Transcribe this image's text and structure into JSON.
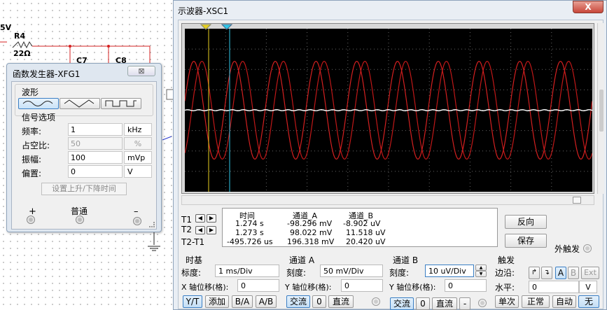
{
  "circuit": {
    "volt_fragment": "5V",
    "r4_label": "R4",
    "r4_value": "22Ω",
    "c7_label": "C7",
    "c8_label": "C8"
  },
  "func_gen": {
    "title": "函数发生器-XFG1",
    "close": "⊠",
    "waveform_label": "波形",
    "signal_options_label": "信号选项",
    "fields": [
      {
        "label": "频率:",
        "value": "1",
        "unit": "kHz"
      },
      {
        "label": "占空比:",
        "value": "50",
        "unit": "%"
      },
      {
        "label": "振幅:",
        "value": "100",
        "unit": "mVp"
      },
      {
        "label": "偏置:",
        "value": "0",
        "unit": "V"
      }
    ],
    "set_rise_fall": "设置上升/下降时间",
    "plus": "+",
    "common": "普通",
    "minus": "–"
  },
  "osc": {
    "title": "示波器-XSC1",
    "close": "X",
    "meas": {
      "headers": [
        "时间",
        "通道_A",
        "通道_B"
      ],
      "rows": [
        {
          "label": "T1",
          "time": "1.274 s",
          "a": "-98.296 mV",
          "b": "-8.902 uV"
        },
        {
          "label": "T2",
          "time": "1.273 s",
          "a": "98.022 mV",
          "b": "11.518 uV"
        },
        {
          "label": "T2-T1",
          "time": "-495.726 us",
          "a": "196.318 mV",
          "b": "20.420 uV"
        }
      ]
    },
    "reverse": "反向",
    "save": "保存",
    "ext_trigger": "外触发",
    "timebase": {
      "title": "时基",
      "scale_label": "标度:",
      "scale": "1 ms/Div",
      "xpos_label": "X 轴位移(格):",
      "xpos": "0",
      "buttons": [
        "Y/T",
        "添加",
        "B/A",
        "A/B"
      ]
    },
    "chA": {
      "title": "通道 A",
      "scale_label": "刻度:",
      "scale": "50 mV/Div",
      "ypos_label": "Y 轴位移(格):",
      "ypos": "0",
      "buttons": [
        "交流",
        "0",
        "直流"
      ]
    },
    "chB": {
      "title": "通道 B",
      "scale_label": "刻度:",
      "scale": "10 uV/Div",
      "ypos_label": "Y 轴位移(格):",
      "ypos": "0",
      "buttons": [
        "交流",
        "0",
        "直流",
        "-"
      ]
    },
    "trigger": {
      "title": "触发",
      "edge_label": "边沿:",
      "edge_buttons": [
        "A",
        "B",
        "Ext"
      ],
      "level_label": "水平:",
      "level": "0",
      "level_unit": "V",
      "modes": [
        "单次",
        "正常",
        "自动",
        "无"
      ]
    }
  },
  "chart_data": {
    "type": "line",
    "timebase": "1 ms/Div",
    "channel_a_scale": "50 mV/Div",
    "series": [
      {
        "name": "通道_A",
        "color": "#d42020",
        "amplitude_div": 2.0,
        "frequency_khz": 1,
        "phase_ms": 0.22
      },
      {
        "name": "通道_B",
        "color": "#ffffff",
        "amplitude_div": 0.0,
        "frequency_khz": 1,
        "phase_ms": 0
      }
    ],
    "second_trace": {
      "color": "#c01818",
      "amplitude_div": 2.0,
      "frequency_khz": 1,
      "phase_ms": 0.42
    },
    "grid": true,
    "divisions_x": 10,
    "divisions_y": 8
  }
}
